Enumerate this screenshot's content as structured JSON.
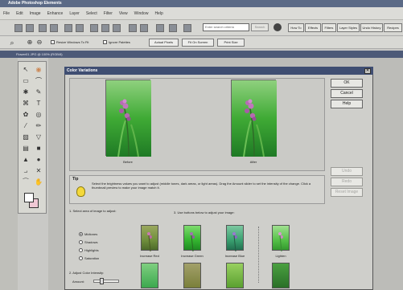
{
  "app": {
    "title": "Adobe Photoshop Elements"
  },
  "menu": [
    "File",
    "Edit",
    "Image",
    "Enhance",
    "Layer",
    "Select",
    "Filter",
    "View",
    "Window",
    "Help"
  ],
  "shortcuts": {
    "search_placeholder": "Enter search criteria",
    "search_button": "Search",
    "palette_buttons": [
      "How To",
      "Effects",
      "Filters",
      "Layer Styles",
      "Undo History",
      "Recipes"
    ]
  },
  "options": {
    "resize_windows_label": "Resize Windows To Fit",
    "ignore_palettes_label": "Ignore Palettes",
    "actual_pixels_label": "Actual Pixels",
    "fit_on_screen_label": "Fit On Screen",
    "print_size_label": "Print Size"
  },
  "document": {
    "tab_title": "Flower01 JPG @ 100% (RGB/8)"
  },
  "dialog": {
    "title": "Color Variations",
    "before_label": "Before",
    "after_label": "After",
    "ok_label": "OK",
    "cancel_label": "Cancel",
    "help_label": "Help",
    "undo_label": "Undo",
    "redo_label": "Redo",
    "reset_label": "Reset Image",
    "tip_heading": "Tip",
    "tip_text": "Select the brightness values you want to adjust (middle tones, dark areas, or light areas). Drag the Amount slider to set the intensity of the change. Click a thumbnail preview to make your image match it.",
    "step1_label": "1. Select area of image to adjust:",
    "areas": [
      "Midtones",
      "Shadows",
      "Highlights",
      "Saturation"
    ],
    "selected_area": "Midtones",
    "step2_label": "2. Adjust Color Intensity:",
    "amount_label": "Amount:",
    "step3_label": "3. Use buttons below to adjust your image:",
    "adjust_buttons": [
      "Increase Red",
      "Increase Green",
      "Increase Blue",
      "Lighten"
    ],
    "amount_value": 0.3
  },
  "colors": {
    "accent": "#3f4e72",
    "dialog_bg": "#cfcfcb"
  },
  "icons": [
    "new-file-icon",
    "open-icon",
    "save-icon",
    "print-icon",
    "help-icon",
    "zoom-icon",
    "hand-icon",
    "tip-bulb-icon"
  ]
}
